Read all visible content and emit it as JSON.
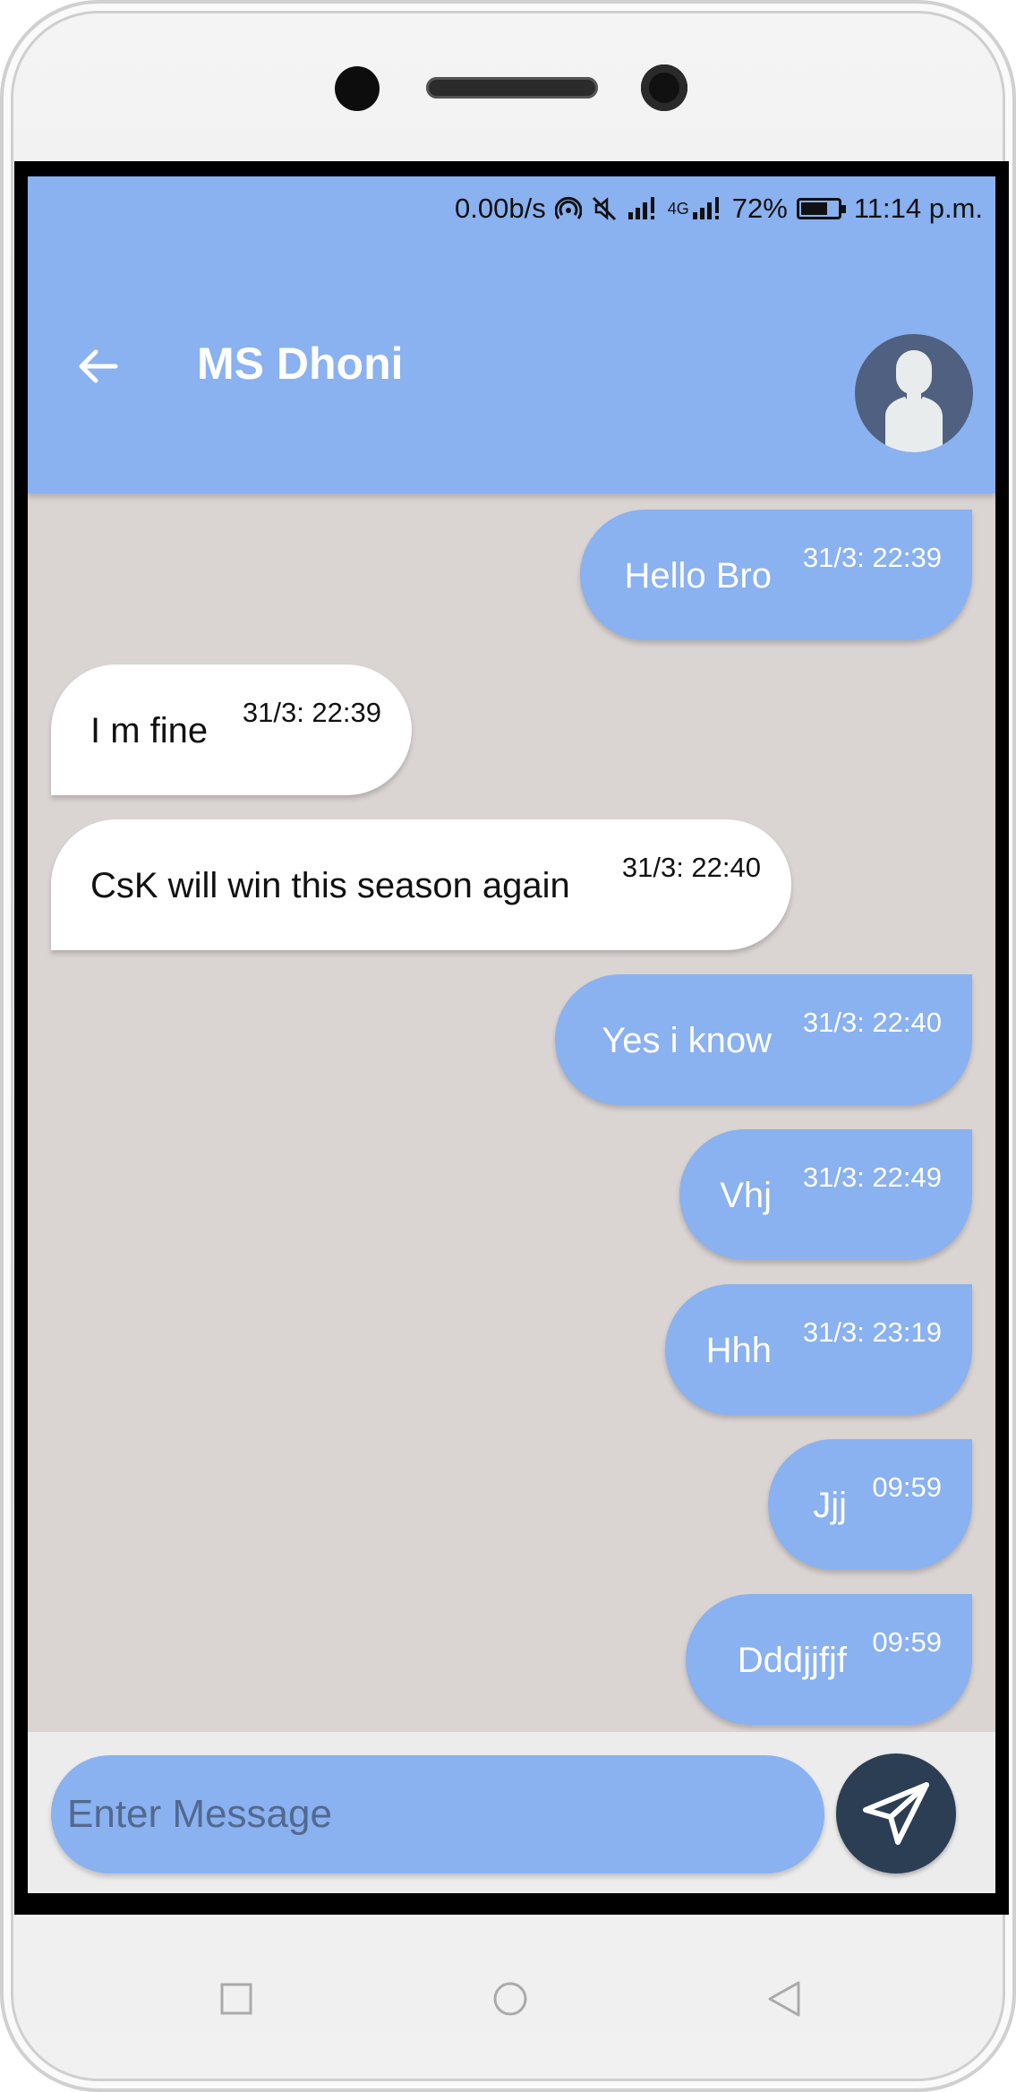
{
  "status_bar": {
    "speed": "0.00b/s",
    "network": "4G",
    "battery": "72%",
    "battery_level": 0.72,
    "time": "11:14 p.m."
  },
  "header": {
    "title": "MS Dhoni",
    "back_icon": "arrow-left-icon",
    "avatar_icon": "person-silhouette-icon"
  },
  "messages": [
    {
      "direction": "sent",
      "text": "Hello Bro",
      "time": "31/3: 22:39"
    },
    {
      "direction": "received",
      "text": "I m fine",
      "time": "31/3: 22:39"
    },
    {
      "direction": "received",
      "text": "CsK will win this season again",
      "time": "31/3: 22:40"
    },
    {
      "direction": "sent",
      "text": "Yes i know",
      "time": "31/3: 22:40"
    },
    {
      "direction": "sent",
      "text": "Vhj",
      "time": "31/3: 22:49"
    },
    {
      "direction": "sent",
      "text": "Hhh",
      "time": "31/3: 23:19"
    },
    {
      "direction": "sent",
      "text": "Jjj",
      "time": "09:59"
    },
    {
      "direction": "sent",
      "text": "Dddjjfjf",
      "time": "09:59"
    }
  ],
  "composer": {
    "placeholder": "Enter Message",
    "value": "",
    "send_icon": "paper-plane-icon"
  },
  "nav": {
    "recent_icon": "square-icon",
    "home_icon": "circle-icon",
    "back_icon": "triangle-back-icon"
  },
  "colors": {
    "primary": "#8ab1f0",
    "chat_background": "#dad4d3",
    "received_bubble": "#ffffff",
    "send_button": "#2c3e54",
    "avatar_background": "#4f6080"
  }
}
